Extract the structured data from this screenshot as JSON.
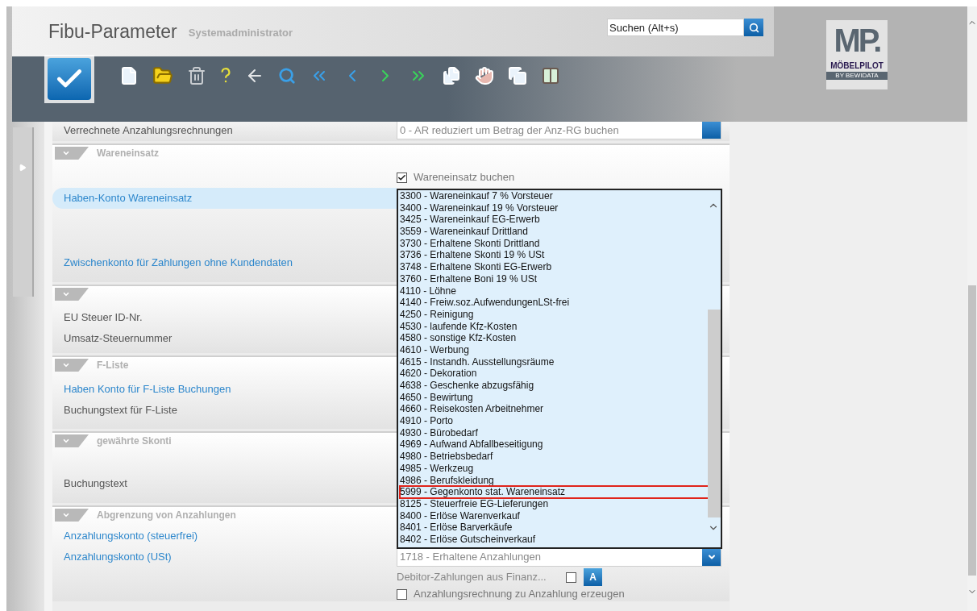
{
  "header": {
    "title": "Fibu-Parameter",
    "user": "Systemadministrator",
    "search": {
      "placeholder": "Suchen (Alt+s)"
    },
    "logo": {
      "mark": "MP.",
      "name": "MÖBELPILOT",
      "tagline": "BY BEWIDATA"
    }
  },
  "toolbar": [
    {
      "kind": "confirm"
    },
    {
      "kind": "new"
    },
    {
      "kind": "open"
    },
    {
      "kind": "delete"
    },
    {
      "kind": "help"
    },
    {
      "kind": "back"
    },
    {
      "kind": "search"
    },
    {
      "kind": "first"
    },
    {
      "kind": "previous"
    },
    {
      "kind": "next"
    },
    {
      "kind": "last"
    },
    {
      "kind": "copy"
    },
    {
      "kind": "hand"
    },
    {
      "kind": "duplicate"
    },
    {
      "kind": "compare"
    }
  ],
  "top_row": {
    "label": "Verrechnete Anzahlungsrechnungen",
    "value": "0 - AR reduziert um Betrag der Anz-RG buchen"
  },
  "sections": [
    {
      "title": "Wareneinsatz",
      "rows": [
        {
          "kind": "checkbox",
          "label": "Wareneinsatz buchen",
          "checked": true
        },
        {
          "kind": "select",
          "label": "Haben-Konto Wareneinsatz",
          "link": true,
          "focused": true
        },
        {
          "kind": "text",
          "label": "Zwischenkonto für Zahlungen ohne Kundendaten",
          "link": true,
          "focused": false
        }
      ]
    },
    {
      "rows": [
        {
          "kind": "text",
          "label": "EU Steuer ID-Nr.",
          "link": false,
          "focused": false
        },
        {
          "kind": "text",
          "label": "Umsatz-Steuernummer",
          "link": false,
          "focused": false
        }
      ]
    },
    {
      "title": "F-Liste",
      "rows": [
        {
          "kind": "select",
          "label": "Haben Konto für F-Liste Buchungen",
          "link": true,
          "focused": false
        },
        {
          "kind": "text",
          "label": "Buchungstext für F-Liste",
          "link": false,
          "focused": false
        }
      ]
    },
    {
      "title": "gewährte Skonti",
      "rows": [
        {
          "kind": "text",
          "label": "Buchungstext",
          "link": false,
          "focused": false
        }
      ]
    },
    {
      "title": "Abgrenzung von Anzahlungen",
      "rows": [
        {
          "kind": "select",
          "label": "Anzahlungskonto (steuerfrei)",
          "link": true,
          "focused": false
        },
        {
          "kind": "select",
          "label": "Anzahlungskonto (USt)",
          "link": true,
          "focused": false,
          "value": "1718 - Erhaltene Anzahlungen"
        },
        {
          "kind": "checkbox-button",
          "label": "Debitor-Zahlungen aus Finanz...",
          "checked": false,
          "button": "A"
        },
        {
          "kind": "checkbox",
          "label": "Anzahlungsrechnung zu Anzahlung erzeugen",
          "checked": false
        }
      ]
    }
  ],
  "dropdown": {
    "items": [
      {
        "label": "3300 - Wareneinkauf 7 % Vorsteuer",
        "selected": false
      },
      {
        "label": "3400 - Wareneinkauf 19 % Vorsteuer",
        "selected": false
      },
      {
        "label": "3425 - Wareneinkauf EG-Erwerb",
        "selected": false
      },
      {
        "label": "3559 - Wareneinkauf Drittland",
        "selected": false
      },
      {
        "label": "3730 - Erhaltene Skonti Drittland",
        "selected": false
      },
      {
        "label": "3736 - Erhaltene Skonti 19 % USt",
        "selected": false
      },
      {
        "label": "3748 - Erhaltene Skonti EG-Erwerb",
        "selected": false
      },
      {
        "label": "3760 - Erhaltene Boni 19 % USt",
        "selected": false
      },
      {
        "label": "4110 - Löhne",
        "selected": false
      },
      {
        "label": "4140 - Freiw.soz.AufwendungenLSt-frei",
        "selected": false
      },
      {
        "label": "4250 - Reinigung",
        "selected": false
      },
      {
        "label": "4530 - laufende Kfz-Kosten",
        "selected": false
      },
      {
        "label": "4580 - sonstige Kfz-Kosten",
        "selected": false
      },
      {
        "label": "4610 - Werbung",
        "selected": false
      },
      {
        "label": "4615 - Instandh. Ausstellungsräume",
        "selected": false
      },
      {
        "label": "4620 - Dekoration",
        "selected": false
      },
      {
        "label": "4638 - Geschenke abzugsfähig",
        "selected": false
      },
      {
        "label": "4650 - Bewirtung",
        "selected": false
      },
      {
        "label": "4660 - Reisekosten Arbeitnehmer",
        "selected": false
      },
      {
        "label": "4910 - Porto",
        "selected": false
      },
      {
        "label": "4930 - Bürobedarf",
        "selected": false
      },
      {
        "label": "4969 - Aufwand Abfallbeseitigung",
        "selected": false
      },
      {
        "label": "4980 - Betriebsbedarf",
        "selected": false
      },
      {
        "label": "4985 - Werkzeug",
        "selected": false
      },
      {
        "label": "4986 - Berufskleidung",
        "selected": false
      },
      {
        "label": "5999 - Gegenkonto stat. Wareneinsatz",
        "selected": true
      },
      {
        "label": "8125 - Steuerfreie EG-Lieferungen",
        "selected": false
      },
      {
        "label": "8400 - Erlöse Warenverkauf",
        "selected": false
      },
      {
        "label": "8401 - Erlöse Barverkäufe",
        "selected": false
      },
      {
        "label": "8402 - Erlöse Gutscheinverkauf",
        "selected": false
      }
    ]
  }
}
